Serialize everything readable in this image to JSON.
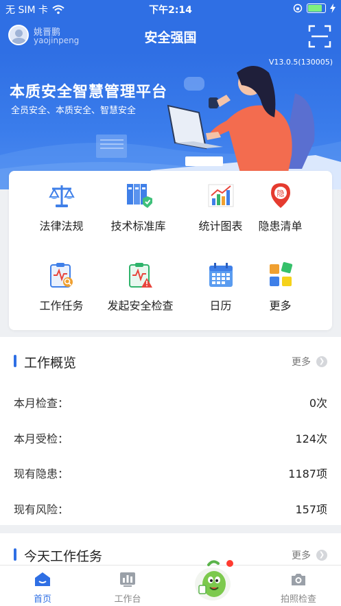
{
  "status_bar": {
    "carrier": "无 SIM 卡",
    "time": "下午2:14",
    "battery_level": 0.85
  },
  "header": {
    "user_name": "姚晋鹏",
    "user_id": "yaojinpeng",
    "title": "安全强国",
    "scan_icon": "scan-icon"
  },
  "banner": {
    "version": "V13.0.5(130005)",
    "title": "本质安全智慧管理平台",
    "subtitle": "全员安全、本质安全、智慧安全"
  },
  "menu": {
    "items": [
      {
        "label": "法律法规",
        "icon": "scales-icon"
      },
      {
        "label": "技术标准库",
        "icon": "binders-icon"
      },
      {
        "label": "统计图表",
        "icon": "bar-chart-icon"
      },
      {
        "label": "隐患清单",
        "icon": "hazard-pin-icon"
      },
      {
        "label": "工作任务",
        "icon": "task-clipboard-icon"
      },
      {
        "label": "发起安全检查",
        "icon": "warning-clipboard-icon"
      },
      {
        "label": "日历",
        "icon": "calendar-icon"
      },
      {
        "label": "更多",
        "icon": "more-tiles-icon"
      }
    ]
  },
  "overview": {
    "title": "工作概览",
    "more": "更多",
    "rows": [
      {
        "label": "本月检查：",
        "value": "0次"
      },
      {
        "label": "本月受检：",
        "value": "124次"
      },
      {
        "label": "现有隐患：",
        "value": "1187项"
      },
      {
        "label": "现有风险：",
        "value": "157项"
      }
    ]
  },
  "tasks": {
    "title": "今天工作任务",
    "more": "更多"
  },
  "tabbar": {
    "tabs": [
      {
        "label": "首页",
        "icon": "home-icon",
        "active": true
      },
      {
        "label": "工作台",
        "icon": "workbench-icon",
        "active": false
      },
      {
        "label": "",
        "icon": "mascot-icon",
        "active": false
      },
      {
        "label": "拍照检查",
        "icon": "camera-icon",
        "active": false
      }
    ]
  },
  "colors": {
    "brand": "#2f6fe4",
    "text": "#222222",
    "muted": "#888888",
    "badge": "#ff3b30"
  }
}
